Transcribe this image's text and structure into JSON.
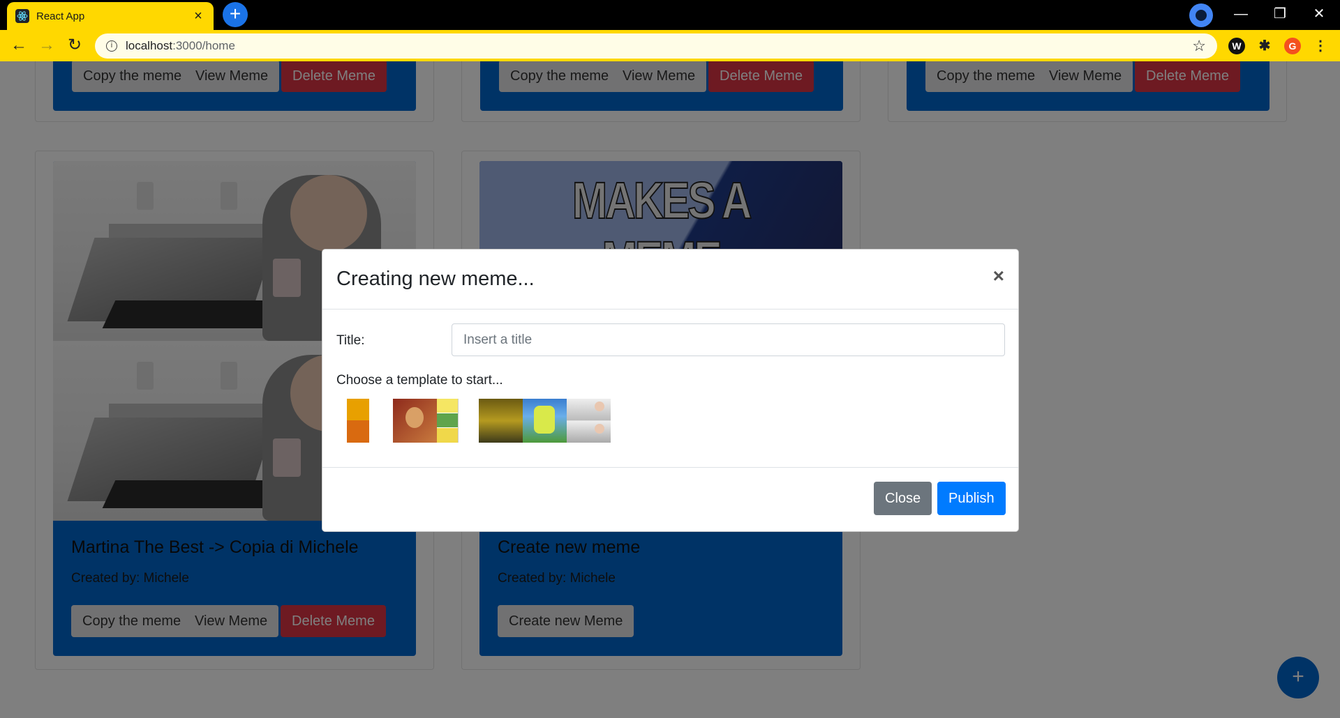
{
  "browser": {
    "tab_title": "React App",
    "url_host": "localhost",
    "url_rest": ":3000/home",
    "profile_initial": "G",
    "ext_initial": "W"
  },
  "top_cards": [
    {
      "copy_label": "Copy the meme",
      "view_label": "View Meme",
      "delete_label": "Delete Meme"
    },
    {
      "copy_label": "Copy the meme",
      "view_label": "View Meme",
      "delete_label": "Delete Meme"
    },
    {
      "copy_label": "Copy the meme",
      "view_label": "View Meme",
      "delete_label": "Delete Meme"
    }
  ],
  "cards": [
    {
      "title": "Martina The Best -> Copia di Michele",
      "created_by": "Created by: Michele",
      "copy_label": "Copy the meme",
      "view_label": "View Meme",
      "delete_label": "Delete Meme"
    },
    {
      "banner_text": "MAKES A MEME",
      "title": "Create new meme",
      "created_by": "Created by: Michele",
      "create_label": "Create new Meme"
    }
  ],
  "fab": {
    "label": "+"
  },
  "modal": {
    "title": "Creating new meme...",
    "close_x": "×",
    "title_label": "Title:",
    "title_placeholder": "Insert a title",
    "title_value": "",
    "choose_label": "Choose a template to start...",
    "templates": [
      {
        "name": "drake",
        "colors": [
          "#e8a000",
          "#c0392b"
        ]
      },
      {
        "name": "kuzco",
        "colors": [
          "#8e2a1c",
          "#d9a066"
        ]
      },
      {
        "name": "spongebob-squares",
        "colors": [
          "#f5e663",
          "#ffffff"
        ]
      },
      {
        "name": "three-headed-dragon",
        "colors": [
          "#b59a20",
          "#3d3a1a"
        ]
      },
      {
        "name": "mocking-spongebob",
        "colors": [
          "#d9e94a",
          "#3a7ecf"
        ]
      },
      {
        "name": "hide-the-pain-harold",
        "colors": [
          "#cfcfcf",
          "#8f8f8f"
        ]
      }
    ],
    "close_label": "Close",
    "publish_label": "Publish",
    "colors": {
      "close": "#6c757d",
      "publish": "#007bff"
    }
  }
}
